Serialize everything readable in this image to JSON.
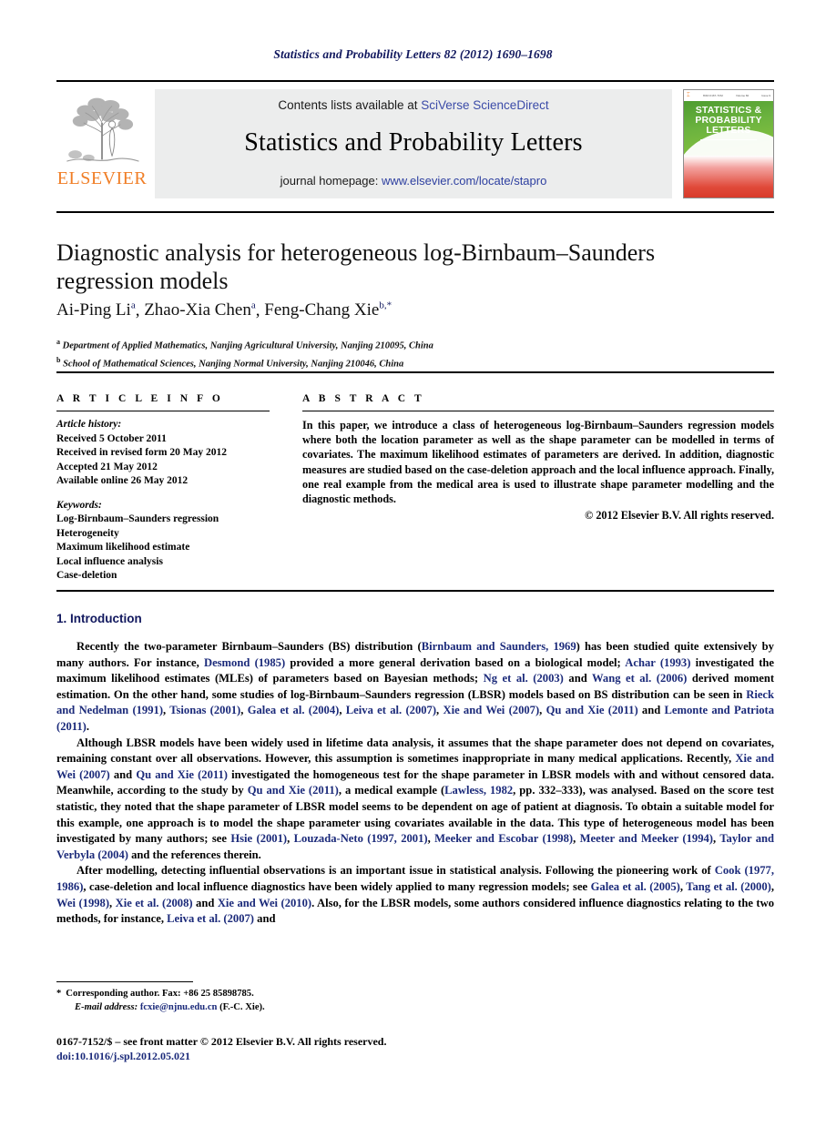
{
  "running_head": "Statistics and Probability Letters 82 (2012) 1690–1698",
  "masthead": {
    "contents_prefix": "Contents lists available at ",
    "sciencedirect_link": "SciVerse ScienceDirect",
    "journal_title": "Statistics and Probability Letters",
    "homepage_prefix": "journal homepage: ",
    "homepage_url": "www.elsevier.com/locate/stapro",
    "publisher": "ELSEVIER",
    "cover": {
      "line1": "STATISTICS &",
      "line2": "PROBABILITY",
      "line3": "LETTERS",
      "header_left": "ISSN 0167-7152",
      "header_mid": "Volume 82",
      "header_right": "Issue 9",
      "elsevier": "ELSEVIER"
    }
  },
  "article": {
    "title": "Diagnostic analysis for heterogeneous log-Birnbaum–Saunders regression models",
    "authors": [
      {
        "name": "Ai-Ping Li",
        "mark": "a"
      },
      {
        "name": "Zhao-Xia Chen",
        "mark": "a"
      },
      {
        "name": "Feng-Chang Xie",
        "mark": "b,*"
      }
    ],
    "affiliations": [
      {
        "mark": "a",
        "text": "Department of Applied Mathematics, Nanjing Agricultural University, Nanjing 210095, China"
      },
      {
        "mark": "b",
        "text": "School of Mathematical Sciences, Nanjing Normal University, Nanjing 210046, China"
      }
    ]
  },
  "article_info": {
    "heading": "A R T I C L E   I N F O",
    "history_label": "Article history:",
    "history": [
      "Received 5 October 2011",
      "Received in revised form 20 May 2012",
      "Accepted 21 May 2012",
      "Available online 26 May 2012"
    ],
    "keywords_label": "Keywords:",
    "keywords": [
      "Log-Birnbaum–Saunders regression",
      "Heterogeneity",
      "Maximum likelihood estimate",
      "Local influence analysis",
      "Case-deletion"
    ]
  },
  "abstract": {
    "heading": "A B S T R A C T",
    "text": "In this paper, we introduce a class of heterogeneous log-Birnbaum–Saunders regression models where both the location parameter as well as the shape parameter can be modelled in terms of covariates. The maximum likelihood estimates of parameters are derived. In addition, diagnostic measures are studied based on the case-deletion approach and the local influence approach. Finally, one real example from the medical area is used to illustrate shape parameter modelling and the diagnostic methods.",
    "copyright": "© 2012 Elsevier B.V. All rights reserved."
  },
  "introduction": {
    "section_number_title": "1.  Introduction",
    "paragraphs": [
      "Recently the two-parameter Birnbaum–Saunders (BS) distribution (Birnbaum and Saunders, 1969) has been studied quite extensively by many authors. For instance, Desmond (1985) provided a more general derivation based on a biological model; Achar (1993) investigated the maximum likelihood estimates (MLEs) of parameters based on Bayesian methods; Ng et al. (2003) and Wang et al. (2006) derived moment estimation. On the other hand, some studies of log-Birnbaum–Saunders regression (LBSR) models based on BS distribution can be seen in Rieck and Nedelman (1991), Tsionas (2001), Galea et al. (2004), Leiva et al. (2007), Xie and Wei (2007), Qu and Xie (2011) and Lemonte and Patriota (2011).",
      "Although LBSR models have been widely used in lifetime data analysis, it assumes that the shape parameter does not depend on covariates, remaining constant over all observations. However, this assumption is sometimes inappropriate in many medical applications. Recently, Xie and Wei (2007) and Qu and Xie (2011) investigated the homogeneous test for the shape parameter in LBSR models with and without censored data. Meanwhile, according to the study by Qu and Xie (2011), a medical example (Lawless, 1982, pp. 332–333), was analysed. Based on the score test statistic, they noted that the shape parameter of LBSR model seems to be dependent on age of patient at diagnosis. To obtain a suitable model for this example, one approach is to model the shape parameter using covariates available in the data. This type of heterogeneous model has been investigated by many authors; see Hsie (2001), Louzada-Neto (1997, 2001), Meeker and Escobar (1998), Meeter and Meeker (1994), Taylor and Verbyla (2004) and the references therein.",
      "After modelling, detecting influential observations is an important issue in statistical analysis. Following the pioneering work of Cook (1977, 1986), case-deletion and local influence diagnostics have been widely applied to many regression models; see Galea et al. (2005), Tang et al. (2000), Wei (1998), Xie et al. (2008) and Xie and Wei (2010). Also, for the LBSR models, some authors considered influence diagnostics relating to the two methods, for instance, Leiva et al. (2007) and"
    ]
  },
  "footer": {
    "corresponding_marker": "*",
    "corresponding_text": "Corresponding author. Fax: +86 25 85898785.",
    "email_label": "E-mail address:",
    "email": "fcxie@njnu.edu.cn",
    "email_suffix": "(F.-C. Xie).",
    "imprint": "0167-7152/$ – see front matter © 2012 Elsevier B.V. All rights reserved.",
    "doi_label": "doi:",
    "doi": "10.1016/j.spl.2012.05.021"
  },
  "colors": {
    "link": "#1b2a7a",
    "running_head": "#11185e",
    "elsevier_orange": "#f07e26",
    "band_gray": "#eceded",
    "sciencedirect": "#3b4ba8"
  }
}
